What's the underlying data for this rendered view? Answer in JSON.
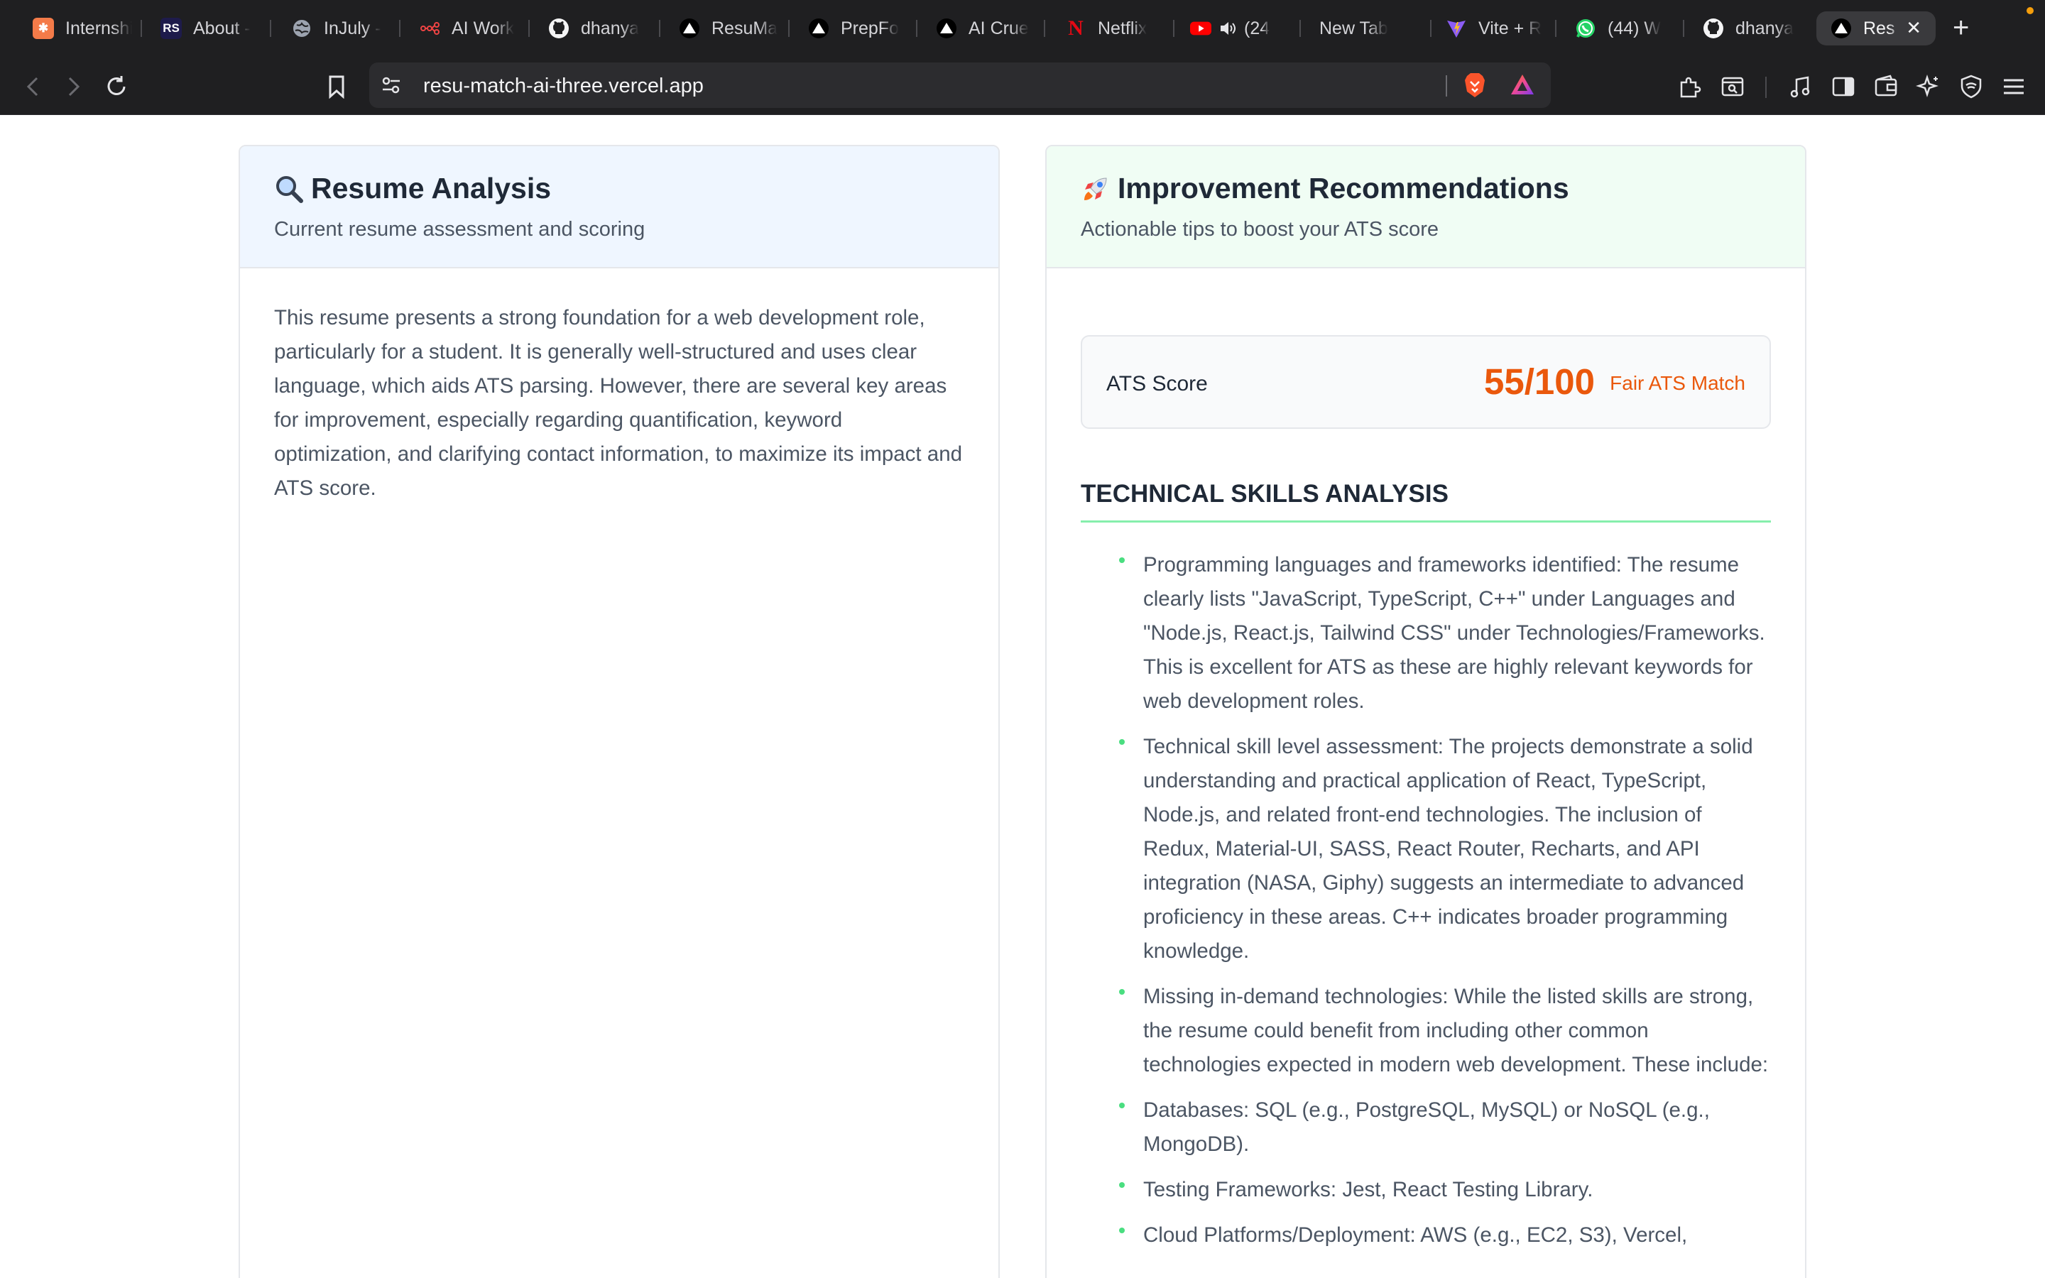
{
  "browser": {
    "tabs": [
      {
        "title": "Internshi",
        "icon": "internshala-icon"
      },
      {
        "title": "About - ",
        "icon": "rs-icon"
      },
      {
        "title": "InJuly - ",
        "icon": "globe-icon"
      },
      {
        "title": "AI Work",
        "icon": "workflow-icon"
      },
      {
        "title": "dhanya",
        "icon": "github-icon"
      },
      {
        "title": "ResuMa",
        "icon": "vercel-icon"
      },
      {
        "title": "PrepFo",
        "icon": "vercel-icon"
      },
      {
        "title": "AI Crue",
        "icon": "vercel-icon"
      },
      {
        "title": "Netflix",
        "icon": "netflix-icon"
      },
      {
        "title": "(24",
        "icon": "youtube-icon"
      },
      {
        "title": "New Tab",
        "icon": ""
      },
      {
        "title": "Vite + R",
        "icon": "vite-icon"
      },
      {
        "title": "(44) W",
        "icon": "whatsapp-icon"
      },
      {
        "title": "dhanya",
        "icon": "github-icon"
      },
      {
        "title": "Res",
        "icon": "vercel-icon",
        "active": true
      }
    ],
    "url": "resu-match-ai-three.vercel.app",
    "accent": "#f59e0b"
  },
  "analysis": {
    "emoji": "🔍",
    "title": "Resume Analysis",
    "subtitle": "Current resume assessment and scoring",
    "summary": "This resume presents a strong foundation for a web development role, particularly for a student. It is generally well-structured and uses clear language, which aids ATS parsing. However, there are several key areas for improvement, especially regarding quantification, keyword optimization, and clarifying contact information, to maximize its impact and ATS score.",
    "header_bg": "#eff6ff"
  },
  "recommendations": {
    "emoji": "🚀",
    "title": "Improvement Recommendations",
    "subtitle": "Actionable tips to boost your ATS score",
    "header_bg": "#f0fdf4",
    "ats": {
      "label": "ATS Score",
      "score": "55/100",
      "rating": "Fair ATS Match",
      "color": "#ea580c"
    },
    "section_title": "TECHNICAL SKILLS ANALYSIS",
    "bullets": [
      "Programming languages and frameworks identified: The resume clearly lists \"JavaScript, TypeScript, C++\" under Languages and \"Node.js, React.js, Tailwind CSS\" under Technologies/Frameworks. This is excellent for ATS as these are highly relevant keywords for web development roles.",
      "Technical skill level assessment: The projects demonstrate a solid understanding and practical application of React, TypeScript, Node.js, and related front-end technologies. The inclusion of Redux, Material-UI, SASS, React Router, Recharts, and API integration (NASA, Giphy) suggests an intermediate to advanced proficiency in these areas. C++ indicates broader programming knowledge.",
      "Missing in-demand technologies: While the listed skills are strong, the resume could benefit from including other common technologies expected in modern web development. These include:",
      "Databases: SQL (e.g., PostgreSQL, MySQL) or NoSQL (e.g., MongoDB).",
      "Testing Frameworks: Jest, React Testing Library.",
      "Cloud Platforms/Deployment: AWS (e.g., EC2, S3), Vercel,"
    ]
  }
}
